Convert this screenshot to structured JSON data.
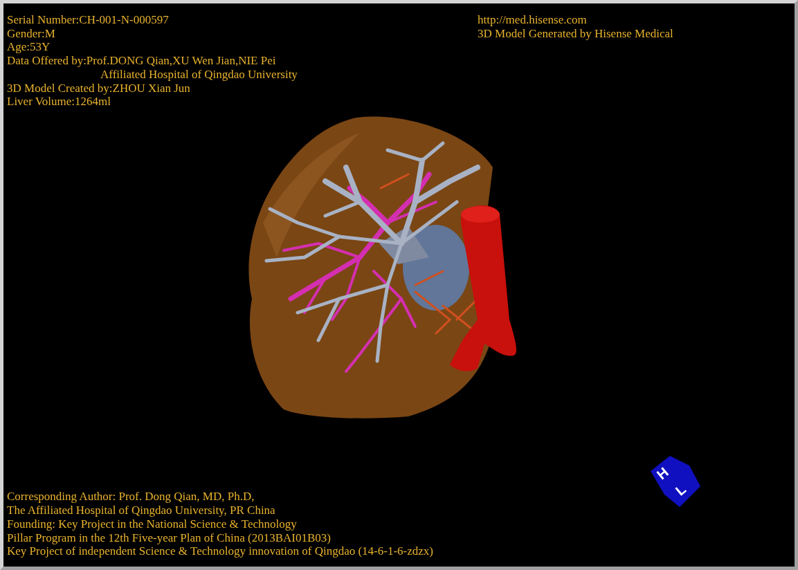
{
  "header_left": [
    {
      "kind": "plain",
      "text": "Serial Number:CH-001-N-000597"
    },
    {
      "kind": "plain",
      "text": "Gender:M"
    },
    {
      "kind": "plain",
      "text": "Age:53Y"
    },
    {
      "kind": "plain",
      "text": "Data Offered by:Prof.DONG Qian,XU Wen Jian,NIE Pei"
    },
    {
      "kind": "indented",
      "text": "Affiliated Hospital of Qingdao University"
    },
    {
      "kind": "plain",
      "text": "3D Model Created by:ZHOU Xian Jun"
    },
    {
      "kind": "plain",
      "text": "Liver Volume:1264ml"
    }
  ],
  "header_right": [
    "http://med.hisense.com",
    "3D Model Generated by Hisense Medical"
  ],
  "footer": [
    "Corresponding Author: Prof. Dong Qian, MD, Ph.D,",
    "The Affiliated Hospital of Qingdao University, PR China",
    "Founding: Key Project in the National Science & Technology",
    "Pillar Program in the 12th Five-year Plan of China (2013BAI01B03)",
    "Key Project of independent Science & Technology innovation of Qingdao (14-6-1-6-zdzx)"
  ],
  "orientation_cube": {
    "labels": [
      "H",
      "L"
    ]
  }
}
